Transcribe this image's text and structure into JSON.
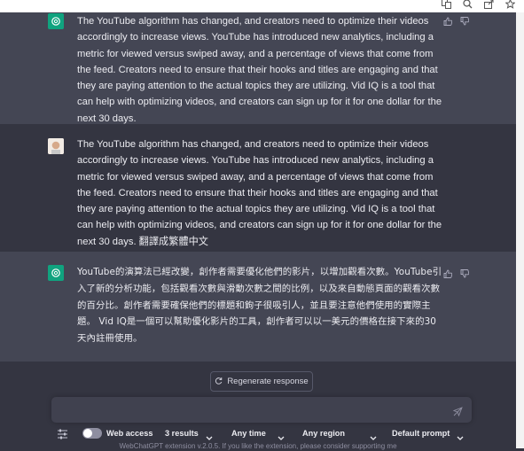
{
  "messages": [
    {
      "role": "assistant",
      "text": "The YouTube algorithm has changed, and creators need to optimize their videos accordingly to increase views. YouTube has introduced new analytics, including a metric for viewed versus swiped away, and a percentage of views that come from the feed. Creators need to ensure that their hooks and titles are engaging and that they are paying attention to the actual topics they are utilizing. Vid IQ is a tool that can help with optimizing videos, and creators can sign up for it for one dollar for the next 30 days."
    },
    {
      "role": "user",
      "text": "The YouTube algorithm has changed, and creators need to optimize their videos accordingly to increase views. YouTube has introduced new analytics, including a metric for viewed versus swiped away, and a percentage of views that come from the feed. Creators need to ensure that their hooks and titles are engaging and that they are paying attention to the actual topics they are utilizing. Vid IQ is a tool that can help with optimizing videos, and creators can sign up for it for one dollar for the next 30 days. 翻譯成繁體中文"
    },
    {
      "role": "assistant",
      "text": "YouTube的演算法已經改變，創作者需要優化他們的影片，以增加觀看次數。YouTube引入了新的分析功能，包括觀看次數與滑動次數之間的比例，以及來自動態頁面的觀看次數的百分比。創作者需要確保他們的標題和鉤子很吸引人，並且要注意他們使用的實際主題。 Vid IQ是一個可以幫助優化影片的工具，創作者可以以一美元的價格在接下來的30天內註冊使用。"
    }
  ],
  "regenerate_label": "Regenerate response",
  "toolbar": {
    "web_access_label": "Web access",
    "results": "3 results",
    "time": "Any time",
    "region": "Any region",
    "prompt": "Default prompt"
  },
  "footer": "WebChatGPT extension v.2.0.5. If you like the extension, please consider supporting me",
  "colors": {
    "accent": "#10a37f",
    "assistant_bg": "#444654",
    "user_bg": "#343541"
  }
}
